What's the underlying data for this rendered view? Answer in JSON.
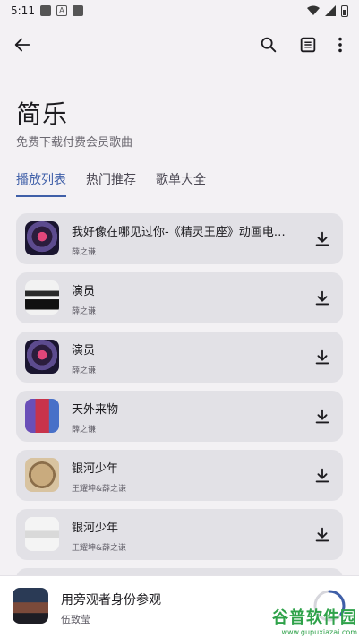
{
  "status_bar": {
    "time": "5:11",
    "icons": [
      "notification-icon",
      "a-icon",
      "app-icon",
      "wifi-icon",
      "signal-icon",
      "battery-icon"
    ]
  },
  "app_bar": {
    "icons": [
      "back-arrow-icon",
      "search-icon",
      "list-view-icon",
      "more-vert-icon"
    ]
  },
  "header": {
    "title": "简乐",
    "subtitle": "免费下载付费会员歌曲"
  },
  "tabs": [
    {
      "label": "播放列表",
      "active": true
    },
    {
      "label": "热门推荐",
      "active": false
    },
    {
      "label": "歌单大全",
      "active": false
    }
  ],
  "songs": [
    {
      "title": "我好像在哪见过你-《精灵王座》动画电影...",
      "artist": "薛之谦",
      "cover": "purple-hands"
    },
    {
      "title": "演员",
      "artist": "薛之谦",
      "cover": "bw-portrait"
    },
    {
      "title": "演员",
      "artist": "薛之谦",
      "cover": "purple-hands"
    },
    {
      "title": "天外来物",
      "artist": "薛之谦",
      "cover": "red-figure"
    },
    {
      "title": "银河少年",
      "artist": "王耀坤&薛之谦",
      "cover": "sepia-round"
    },
    {
      "title": "银河少年",
      "artist": "王耀坤&薛之谦",
      "cover": "light-gray"
    }
  ],
  "now_playing": {
    "title": "用旁观者身份参观",
    "artist": "伍致莹",
    "progress": 0.35
  },
  "watermark": {
    "top": "谷普软件园",
    "bottom": "www.gupuxiazai.com"
  },
  "colors": {
    "accent": "#3f5fa8",
    "card": "#e2e1e6",
    "background": "#f3f1f4"
  }
}
